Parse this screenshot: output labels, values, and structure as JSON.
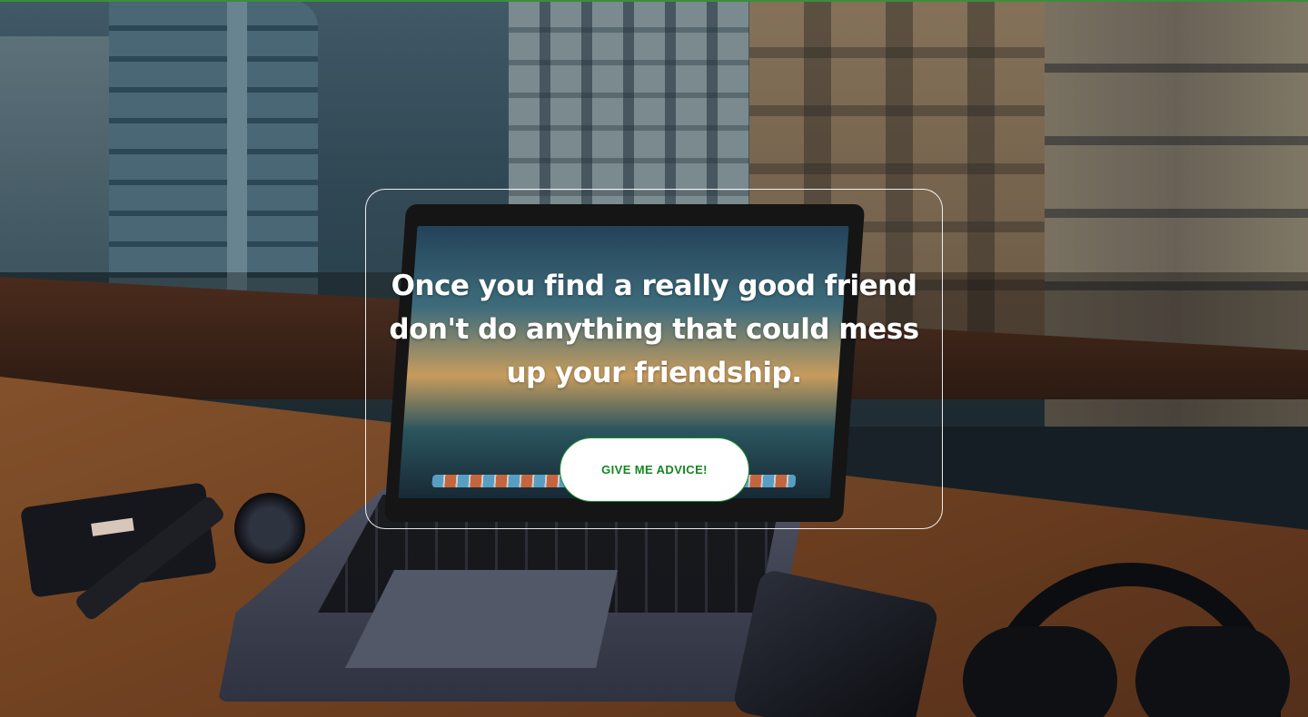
{
  "background": {
    "description_colors": {
      "accent_line": "#3a8f3a"
    }
  },
  "card": {
    "quote": "Once you find a really good friend don't do anything that could mess up your friendship.",
    "button_label": "GIVE ME ADVICE!",
    "button_color": "#13871f"
  }
}
